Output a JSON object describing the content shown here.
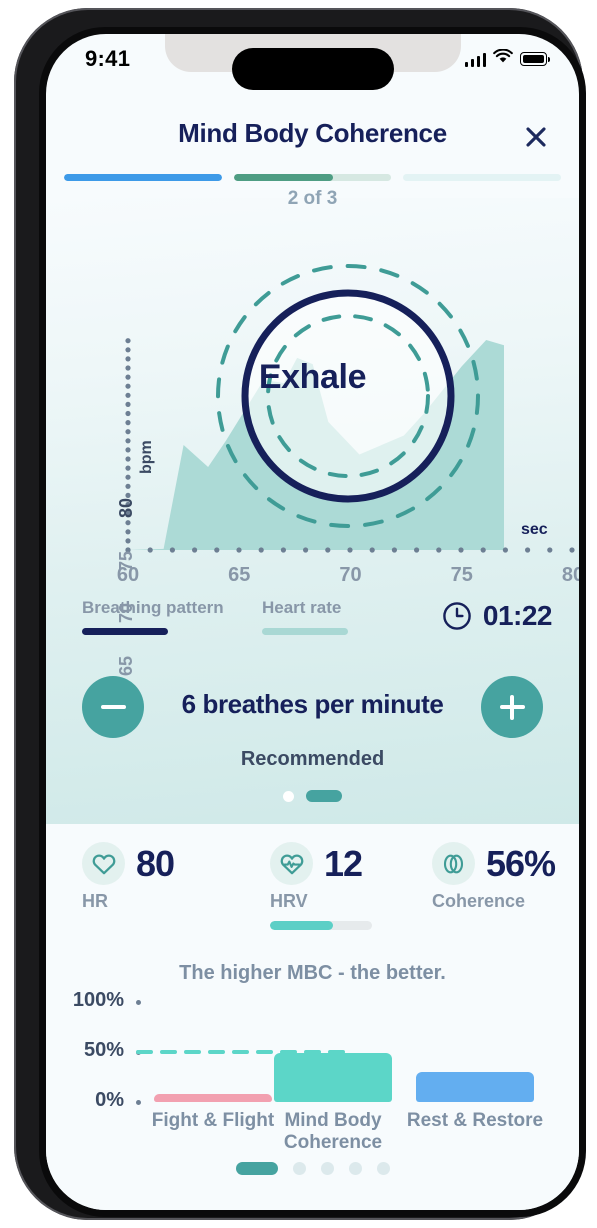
{
  "status_bar": {
    "time": "9:41",
    "signal_icon": "cellular-signal-icon",
    "wifi_icon": "wifi-icon",
    "battery_icon": "battery-icon"
  },
  "header": {
    "title": "Mind Body Coherence",
    "close_icon": "close-icon",
    "step_label": "2 of 3",
    "progress": [
      {
        "fill_pct": 100,
        "color": "#3d9ae8",
        "track": "#eaf4fc"
      },
      {
        "fill_pct": 63,
        "color": "#4e9d83",
        "track": "#d6e8e2"
      },
      {
        "fill_pct": 0,
        "color": "#e3f3f4",
        "track": "#e3f3f4"
      }
    ]
  },
  "breathing": {
    "state_label": "Exhale",
    "circle_outer_icon": "breath-guide-outer-ring",
    "circle_mid_icon": "breath-guide-solid-ring",
    "circle_inner_icon": "breath-guide-inner-ring",
    "legend": [
      {
        "label": "Breathing pattern",
        "color": "#16205a"
      },
      {
        "label": "Heart rate",
        "color": "#a9d8d4"
      }
    ],
    "timer": {
      "icon": "clock-icon",
      "value": "01:22"
    },
    "rate": {
      "text": "6 breathes per minute",
      "note": "Recommended",
      "minus_icon": "minus-icon",
      "plus_icon": "plus-icon",
      "dots": [
        {
          "active": false
        },
        {
          "active": true
        }
      ]
    }
  },
  "chart_data": {
    "type": "area",
    "title": "",
    "xlabel": "sec",
    "ylabel": "bpm",
    "xlim": [
      60,
      80
    ],
    "ylim": [
      60,
      80
    ],
    "xticks": [
      60,
      65,
      70,
      75,
      80
    ],
    "yticks": [
      60,
      65,
      70,
      75,
      80
    ],
    "grid": false,
    "series": [
      {
        "name": "Heart rate",
        "color": "#a9d8d4",
        "x": [
          60.0,
          61.6,
          62.5,
          63.6,
          64.4,
          66.1,
          67.0,
          67.6,
          68.3,
          69.0,
          70.4,
          72.4,
          73.3,
          75.0,
          76.1,
          76.9
        ],
        "y": [
          60.0,
          60.1,
          70.0,
          67.9,
          70.4,
          76.2,
          75.9,
          78.3,
          77.7,
          72.2,
          69.1,
          70.9,
          73.0,
          77.5,
          80.0,
          79.5
        ]
      }
    ]
  },
  "metrics": [
    {
      "icon": "heart-outline-icon",
      "value": "80",
      "label": "HR",
      "progress_pct": null
    },
    {
      "icon": "heart-pulse-icon",
      "value": "12",
      "label": "HRV",
      "progress_pct": 62
    },
    {
      "icon": "coherence-rings-icon",
      "value": "56%",
      "label": "Coherence",
      "progress_pct": null
    }
  ],
  "bottom": {
    "caption": "The higher MBC - the better.",
    "pagination": [
      {
        "active": true
      },
      {
        "active": false
      },
      {
        "active": false
      },
      {
        "active": false
      },
      {
        "active": false
      }
    ]
  },
  "bottom_chart_data": {
    "type": "bar",
    "title": "The higher MBC - the better.",
    "categories": [
      "Fight & Flight",
      "Mind Body\nCoherence",
      "Rest & Restore"
    ],
    "values": [
      8,
      49,
      30
    ],
    "colors": [
      "#f2a0b0",
      "#5cd6c8",
      "#63aef0"
    ],
    "ylabel": "",
    "ylim": [
      0,
      100
    ],
    "yticks": [
      0,
      50,
      100
    ],
    "ytick_labels": [
      "0%",
      "50%",
      "100%"
    ],
    "reference_line": {
      "value": 50,
      "style": "dashed",
      "color": "#5cd6c8"
    },
    "grid": false
  }
}
